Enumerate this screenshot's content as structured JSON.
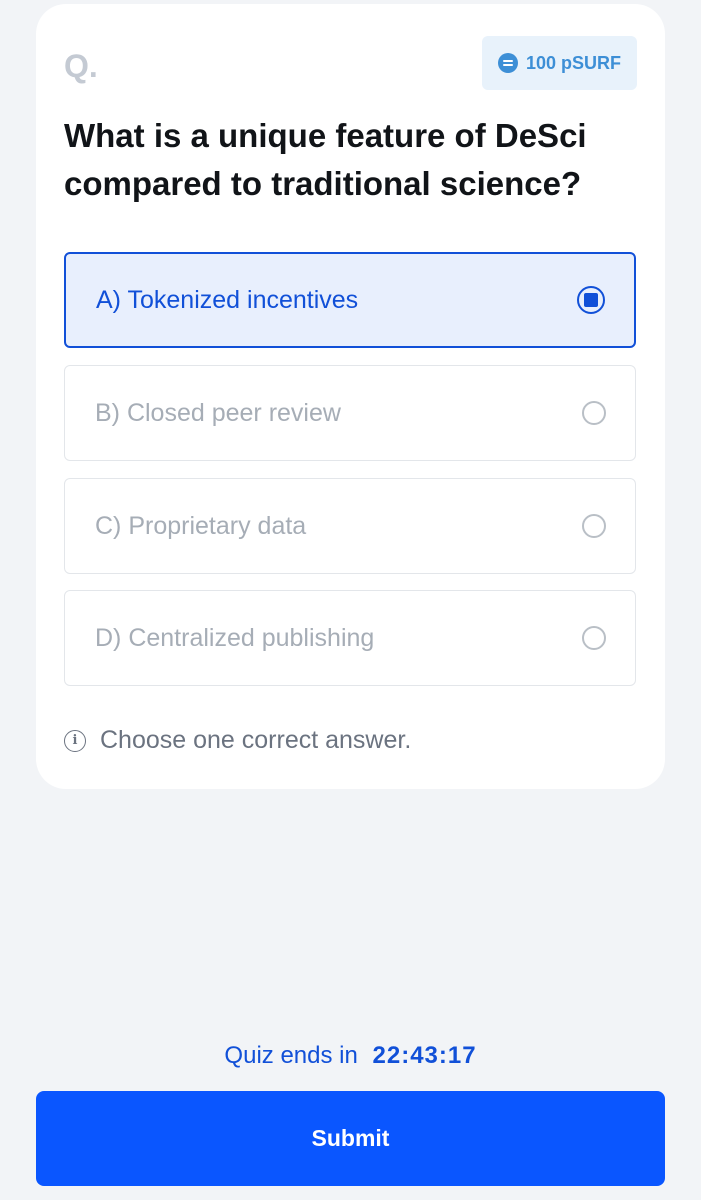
{
  "card": {
    "q_label": "Q.",
    "reward": {
      "icon": "surf-coin-icon",
      "text": "100 pSURF"
    },
    "question": "What is a unique feature of DeSci compared to traditional science?",
    "options": [
      {
        "label": "A) Tokenized incentives",
        "selected": true
      },
      {
        "label": "B) Closed peer review",
        "selected": false
      },
      {
        "label": "C) Proprietary data",
        "selected": false
      },
      {
        "label": "D) Centralized publishing",
        "selected": false
      }
    ],
    "hint": {
      "icon": "info-icon",
      "text": "Choose one correct answer."
    }
  },
  "footer": {
    "timer_label": "Quiz ends in",
    "timer_value": "22:43:17",
    "submit_label": "Submit"
  },
  "colors": {
    "accent": "#1150d8",
    "submit": "#0a56ff",
    "reward": "#3d8fd6",
    "background": "#f2f4f7"
  }
}
